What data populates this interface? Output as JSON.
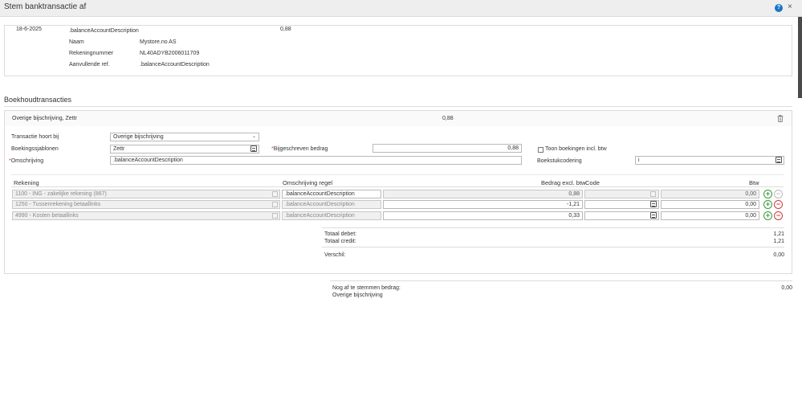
{
  "window": {
    "title": "Stem banktransactie af",
    "help_label": "?",
    "close_label": "×"
  },
  "bank_transaction": {
    "date": "18-6-2025",
    "description": ".balanceAccountDescription",
    "amount": "0,88",
    "details": [
      {
        "label": "Naam",
        "value": "Mystore.no AS"
      },
      {
        "label": "Rekeningnummer",
        "value": "NL40ADYB2006011709"
      },
      {
        "label": "Aanvullende ref.",
        "value": ".balanceAccountDescription"
      }
    ]
  },
  "section": {
    "heading": "Boekhoudtransacties"
  },
  "booking": {
    "header_title": "Overige bijschrijving, Zettr",
    "header_amount": "0,88",
    "transaction_type_label": "Transactie hoort bij",
    "transaction_type_value": "Overige bijschrijving",
    "template_label": "Boekingssjablonen",
    "template_value": "Zettr",
    "credited_amount_label": "Bijgeschreven bedrag",
    "credited_amount_value": "0,88",
    "description_label": "Omschrijving",
    "description_value": ".balanceAccountDescription",
    "show_vat_label": "Toon boekingen incl. btw",
    "show_vat_checked": false,
    "document_code_label": "Boekstukcodering",
    "document_code_value": "i",
    "required_marker": "*"
  },
  "lines_table": {
    "columns": {
      "account": "Rekening",
      "description": "Omschrijving regel",
      "amount": "Bedrag excl. btw",
      "code": "Code",
      "vat": "Btw"
    },
    "rows": [
      {
        "account": "1100 - ING - zakelijke rekening (867)",
        "description": ".balanceAccountDescription",
        "amount": "0,88",
        "code": "",
        "vat": "0,00"
      },
      {
        "account": "1250 - Tussenrekening betaallinks",
        "description": ".balanceAccountDescription",
        "amount": "-1,21",
        "code": "",
        "vat": "0,00"
      },
      {
        "account": "4990 - Kosten betaallinks",
        "description": ".balanceAccountDescription",
        "amount": "0,33",
        "code": "",
        "vat": "0,00"
      }
    ],
    "add_label": "+",
    "remove_label": "−"
  },
  "totals": {
    "debit_label": "Totaal debet:",
    "debit_value": "1,21",
    "credit_label": "Totaal credit:",
    "credit_value": "1,21",
    "difference_label": "Verschil:",
    "difference_value": "0,00"
  },
  "remaining": {
    "label": "Nog af te stemmen bedrag:",
    "value": "0,00",
    "type": "Overige bijschrijving"
  },
  "colors": {
    "accent": "#1a73c8",
    "add": "#3a9a3a",
    "remove": "#d03c3c"
  }
}
